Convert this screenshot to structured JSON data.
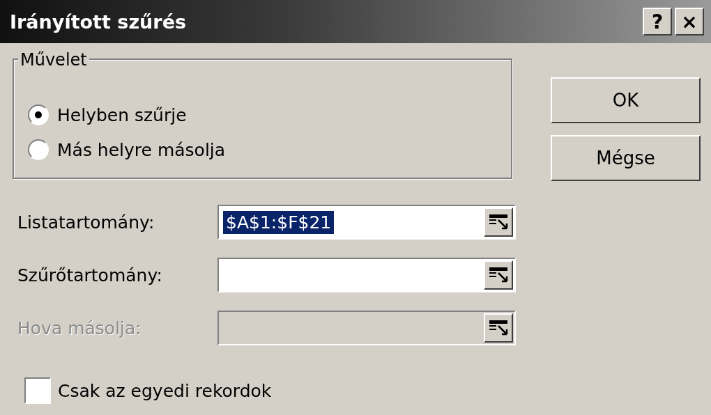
{
  "window": {
    "title": "Irányított szűrés",
    "buttons": [
      "?",
      "×"
    ]
  },
  "action_group": {
    "label": "Művelet",
    "options": [
      {
        "label": "Helyben szűrje",
        "selected": true
      },
      {
        "label": "Más helyre másolja",
        "selected": false
      }
    ]
  },
  "buttons": [
    "OK",
    "Mégse"
  ],
  "fields": [
    {
      "label": "Listatartomány:",
      "value": "$A$1:$F$21",
      "text_selected": true,
      "disabled": false
    },
    {
      "label": "Szűrőtartomány:",
      "disabled": false
    },
    {
      "label": "Hova másolja:",
      "disabled": true
    }
  ],
  "unique_records": {
    "label": "Csak az egyedi rekordok",
    "checked": false
  }
}
